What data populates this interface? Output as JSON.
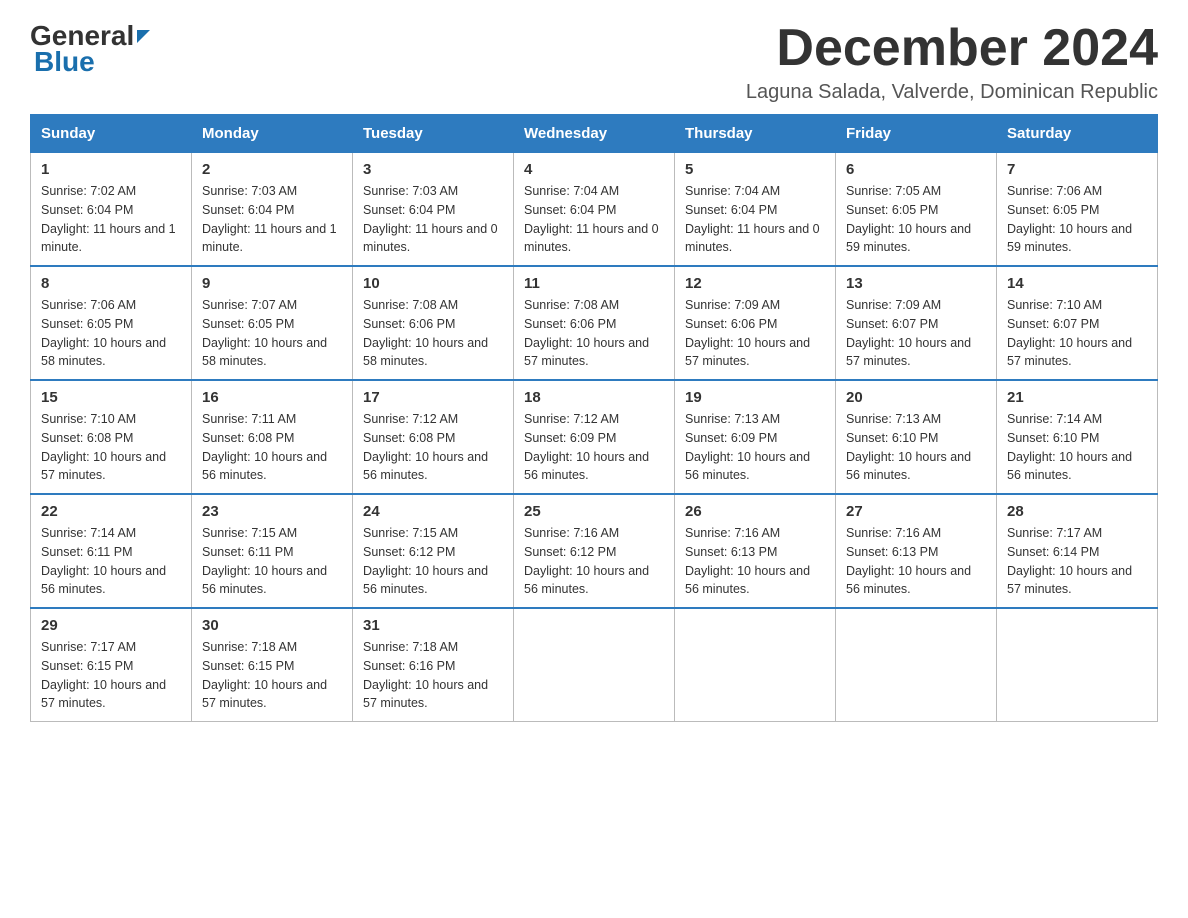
{
  "header": {
    "logo_general": "General",
    "logo_blue": "Blue",
    "month_title": "December 2024",
    "location": "Laguna Salada, Valverde, Dominican Republic"
  },
  "weekdays": [
    "Sunday",
    "Monday",
    "Tuesday",
    "Wednesday",
    "Thursday",
    "Friday",
    "Saturday"
  ],
  "weeks": [
    [
      {
        "day": "1",
        "sunrise": "7:02 AM",
        "sunset": "6:04 PM",
        "daylight": "11 hours and 1 minute."
      },
      {
        "day": "2",
        "sunrise": "7:03 AM",
        "sunset": "6:04 PM",
        "daylight": "11 hours and 1 minute."
      },
      {
        "day": "3",
        "sunrise": "7:03 AM",
        "sunset": "6:04 PM",
        "daylight": "11 hours and 0 minutes."
      },
      {
        "day": "4",
        "sunrise": "7:04 AM",
        "sunset": "6:04 PM",
        "daylight": "11 hours and 0 minutes."
      },
      {
        "day": "5",
        "sunrise": "7:04 AM",
        "sunset": "6:04 PM",
        "daylight": "11 hours and 0 minutes."
      },
      {
        "day": "6",
        "sunrise": "7:05 AM",
        "sunset": "6:05 PM",
        "daylight": "10 hours and 59 minutes."
      },
      {
        "day": "7",
        "sunrise": "7:06 AM",
        "sunset": "6:05 PM",
        "daylight": "10 hours and 59 minutes."
      }
    ],
    [
      {
        "day": "8",
        "sunrise": "7:06 AM",
        "sunset": "6:05 PM",
        "daylight": "10 hours and 58 minutes."
      },
      {
        "day": "9",
        "sunrise": "7:07 AM",
        "sunset": "6:05 PM",
        "daylight": "10 hours and 58 minutes."
      },
      {
        "day": "10",
        "sunrise": "7:08 AM",
        "sunset": "6:06 PM",
        "daylight": "10 hours and 58 minutes."
      },
      {
        "day": "11",
        "sunrise": "7:08 AM",
        "sunset": "6:06 PM",
        "daylight": "10 hours and 57 minutes."
      },
      {
        "day": "12",
        "sunrise": "7:09 AM",
        "sunset": "6:06 PM",
        "daylight": "10 hours and 57 minutes."
      },
      {
        "day": "13",
        "sunrise": "7:09 AM",
        "sunset": "6:07 PM",
        "daylight": "10 hours and 57 minutes."
      },
      {
        "day": "14",
        "sunrise": "7:10 AM",
        "sunset": "6:07 PM",
        "daylight": "10 hours and 57 minutes."
      }
    ],
    [
      {
        "day": "15",
        "sunrise": "7:10 AM",
        "sunset": "6:08 PM",
        "daylight": "10 hours and 57 minutes."
      },
      {
        "day": "16",
        "sunrise": "7:11 AM",
        "sunset": "6:08 PM",
        "daylight": "10 hours and 56 minutes."
      },
      {
        "day": "17",
        "sunrise": "7:12 AM",
        "sunset": "6:08 PM",
        "daylight": "10 hours and 56 minutes."
      },
      {
        "day": "18",
        "sunrise": "7:12 AM",
        "sunset": "6:09 PM",
        "daylight": "10 hours and 56 minutes."
      },
      {
        "day": "19",
        "sunrise": "7:13 AM",
        "sunset": "6:09 PM",
        "daylight": "10 hours and 56 minutes."
      },
      {
        "day": "20",
        "sunrise": "7:13 AM",
        "sunset": "6:10 PM",
        "daylight": "10 hours and 56 minutes."
      },
      {
        "day": "21",
        "sunrise": "7:14 AM",
        "sunset": "6:10 PM",
        "daylight": "10 hours and 56 minutes."
      }
    ],
    [
      {
        "day": "22",
        "sunrise": "7:14 AM",
        "sunset": "6:11 PM",
        "daylight": "10 hours and 56 minutes."
      },
      {
        "day": "23",
        "sunrise": "7:15 AM",
        "sunset": "6:11 PM",
        "daylight": "10 hours and 56 minutes."
      },
      {
        "day": "24",
        "sunrise": "7:15 AM",
        "sunset": "6:12 PM",
        "daylight": "10 hours and 56 minutes."
      },
      {
        "day": "25",
        "sunrise": "7:16 AM",
        "sunset": "6:12 PM",
        "daylight": "10 hours and 56 minutes."
      },
      {
        "day": "26",
        "sunrise": "7:16 AM",
        "sunset": "6:13 PM",
        "daylight": "10 hours and 56 minutes."
      },
      {
        "day": "27",
        "sunrise": "7:16 AM",
        "sunset": "6:13 PM",
        "daylight": "10 hours and 56 minutes."
      },
      {
        "day": "28",
        "sunrise": "7:17 AM",
        "sunset": "6:14 PM",
        "daylight": "10 hours and 57 minutes."
      }
    ],
    [
      {
        "day": "29",
        "sunrise": "7:17 AM",
        "sunset": "6:15 PM",
        "daylight": "10 hours and 57 minutes."
      },
      {
        "day": "30",
        "sunrise": "7:18 AM",
        "sunset": "6:15 PM",
        "daylight": "10 hours and 57 minutes."
      },
      {
        "day": "31",
        "sunrise": "7:18 AM",
        "sunset": "6:16 PM",
        "daylight": "10 hours and 57 minutes."
      },
      null,
      null,
      null,
      null
    ]
  ]
}
